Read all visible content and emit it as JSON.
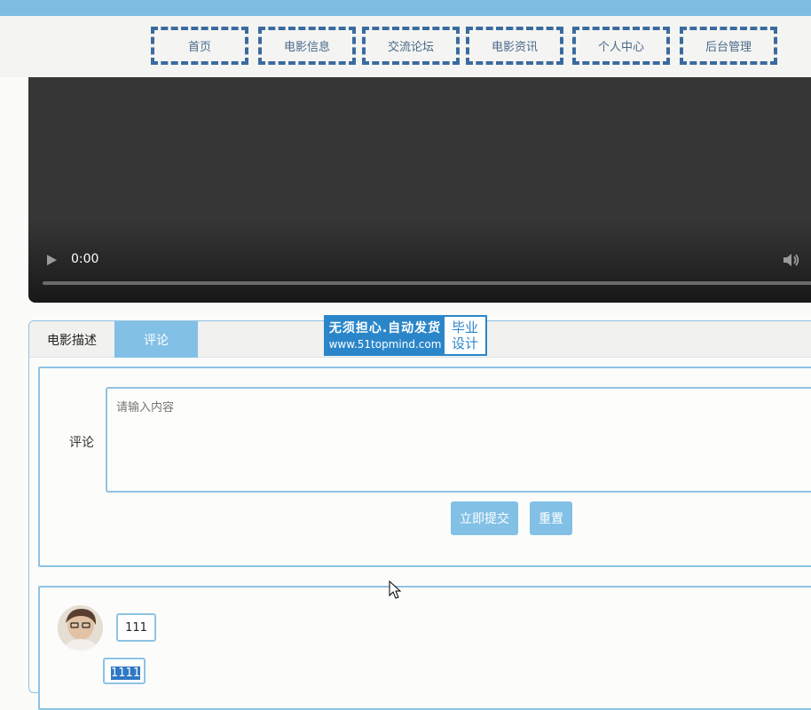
{
  "nav": {
    "items": [
      {
        "label": "首页"
      },
      {
        "label": "电影信息"
      },
      {
        "label": "交流论坛"
      },
      {
        "label": "电影资讯"
      },
      {
        "label": "个人中心"
      },
      {
        "label": "后台管理"
      }
    ]
  },
  "video": {
    "time": "0:00",
    "progress": 0
  },
  "tabs": {
    "description": "电影描述",
    "comment": "评论",
    "active": "comment"
  },
  "ad": {
    "title": "无须担心.自动发货",
    "url": "www.51topmind.com",
    "badge_line1": "毕业",
    "badge_line2": "设计"
  },
  "comment_form": {
    "label": "评论",
    "placeholder": "请输入内容",
    "submit_label": "立即提交",
    "reset_label": "重置"
  },
  "comments": [
    {
      "user": "111",
      "text": "1111"
    }
  ],
  "colors": {
    "accent": "#82c0e6",
    "nav_border": "#3a6ba0",
    "topbar": "#7fbee3"
  }
}
